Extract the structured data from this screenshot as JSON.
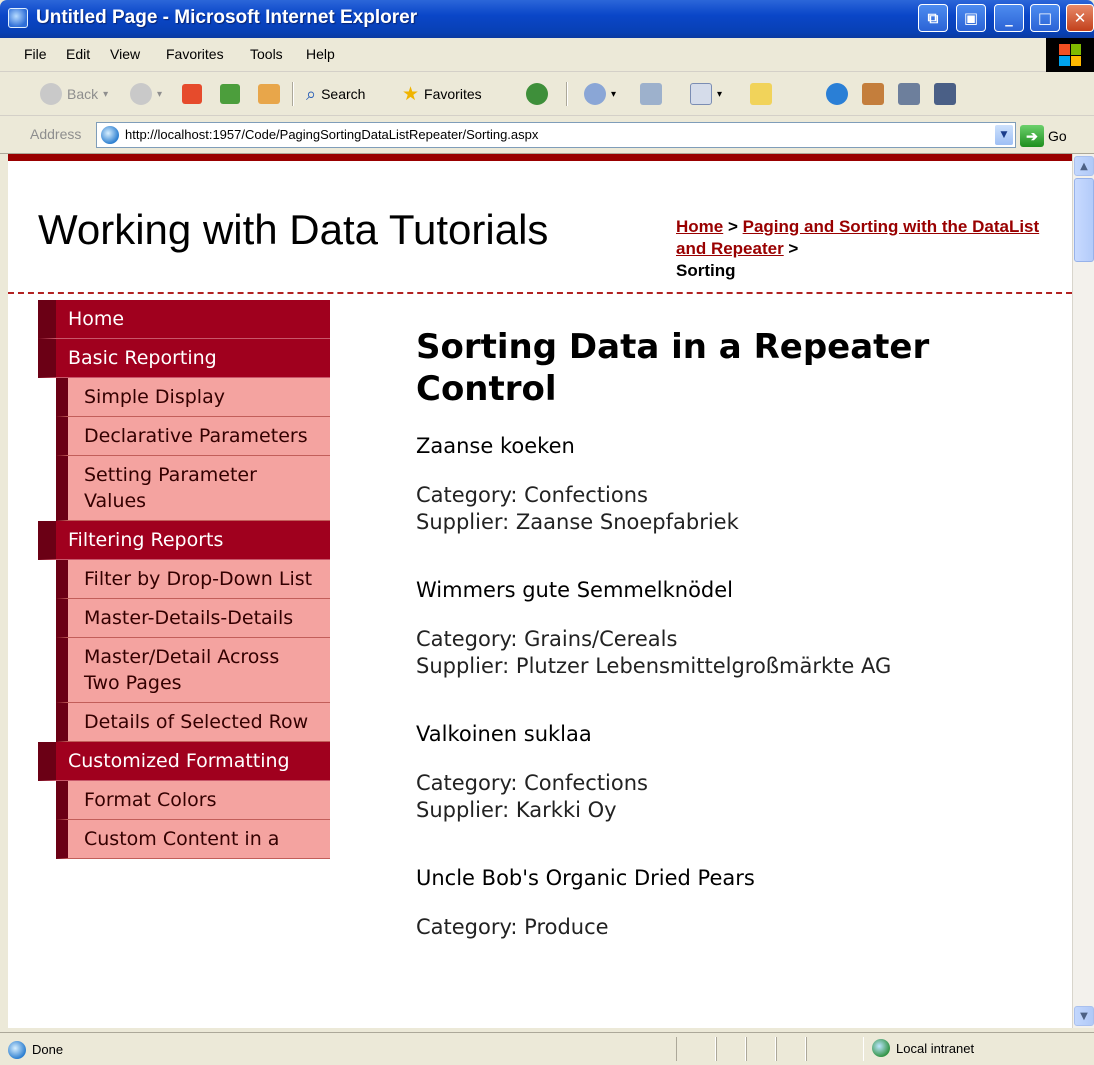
{
  "window": {
    "title": "Untitled Page - Microsoft Internet Explorer"
  },
  "menu": [
    "File",
    "Edit",
    "View",
    "Favorites",
    "Tools",
    "Help"
  ],
  "toolbar": {
    "back": "Back",
    "search": "Search",
    "favorites": "Favorites"
  },
  "address": {
    "label": "Address",
    "url": "http://localhost:1957/Code/PagingSortingDataListRepeater/Sorting.aspx",
    "go": "Go"
  },
  "site": {
    "title": "Working with Data Tutorials"
  },
  "breadcrumb": {
    "home": "Home",
    "sep1": " > ",
    "parent": "Paging and Sorting with the DataList and Repeater",
    "sep2": " > ",
    "current": "Sorting"
  },
  "sidebar": {
    "items": [
      {
        "label": "Home",
        "level": "top"
      },
      {
        "label": "Basic Reporting",
        "level": "top"
      },
      {
        "label": "Simple Display",
        "level": "sub"
      },
      {
        "label": "Declarative Parameters",
        "level": "sub"
      },
      {
        "label": "Setting Parameter Values",
        "level": "sub"
      },
      {
        "label": "Filtering Reports",
        "level": "top"
      },
      {
        "label": "Filter by Drop-Down List",
        "level": "sub"
      },
      {
        "label": "Master-Details-Details",
        "level": "sub"
      },
      {
        "label": "Master/Detail Across Two Pages",
        "level": "sub"
      },
      {
        "label": "Details of Selected Row",
        "level": "sub"
      },
      {
        "label": "Customized Formatting",
        "level": "top"
      },
      {
        "label": "Format Colors",
        "level": "sub"
      },
      {
        "label": "Custom Content in a",
        "level": "sub"
      }
    ]
  },
  "content": {
    "heading": "Sorting Data in a Repeater Control",
    "products": [
      {
        "name": "Zaanse koeken",
        "category": "Category: Confections",
        "supplier": "Supplier: Zaanse Snoepfabriek"
      },
      {
        "name": "Wimmers gute Semmelknödel",
        "category": "Category: Grains/Cereals",
        "supplier": "Supplier: Plutzer Lebensmittelgroßmärkte AG"
      },
      {
        "name": "Valkoinen suklaa",
        "category": "Category: Confections",
        "supplier": "Supplier: Karkki Oy"
      },
      {
        "name": "Uncle Bob's Organic Dried Pears",
        "category": "Category: Produce",
        "supplier": ""
      }
    ]
  },
  "status": {
    "text": "Done",
    "zone": "Local intranet"
  }
}
